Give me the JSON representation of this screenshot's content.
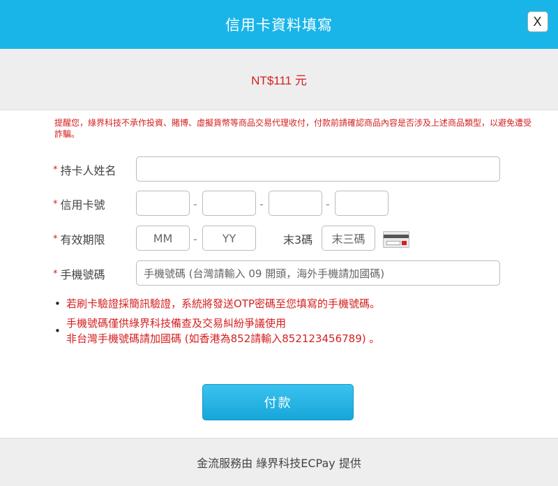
{
  "header": {
    "title": "信用卡資料填寫",
    "close_label": "X"
  },
  "amount": "NT$111 元",
  "notice": "提醒您，綠界科技不承作投資、賭博、虛擬貨幣等商品交易代理收付，付款前請確認商品內容是否涉及上述商品類型，以避免遭受詐騙。",
  "form": {
    "required_mark": "*",
    "cardholder": {
      "label": "持卡人姓名",
      "value": ""
    },
    "card_number": {
      "label": "信用卡號",
      "separator": "-",
      "parts": [
        "",
        "",
        "",
        ""
      ]
    },
    "expiry": {
      "label": "有效期限",
      "month_placeholder": "MM",
      "year_placeholder": "YY",
      "separator": "-"
    },
    "cvv": {
      "label": "末3碼",
      "placeholder": "末三碼",
      "icon": "card-back-icon"
    },
    "phone": {
      "label": "手機號碼",
      "placeholder": "手機號碼 (台灣請輸入 09 開頭，海外手機請加國碼)"
    }
  },
  "info": {
    "bullet": "•",
    "line1": "若刷卡驗證採簡訊驗證，系統將發送OTP密碼至您填寫的手機號碼。",
    "line2": "手機號碼僅供綠界科技備查及交易糾紛爭議使用",
    "line3": "非台灣手機號碼請加國碼 (如香港為852請輸入852123456789) 。"
  },
  "pay_button": "付款",
  "footer": "金流服務由 綠界科技ECPay 提供",
  "colors": {
    "header": "#1ab5e8",
    "warning_text": "#d42020",
    "button": "#17a6d9"
  }
}
